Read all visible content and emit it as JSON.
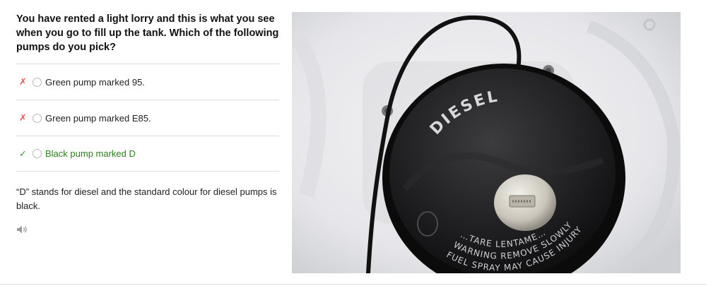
{
  "question": "You have rented a light lorry and this is what you see when you go to fill up the tank. Which of the following pumps do you pick?",
  "answers": [
    {
      "mark": "✗",
      "label": "Green pump marked 95.",
      "status": "incorrect"
    },
    {
      "mark": "✗",
      "label": "Green pump marked E85.",
      "status": "incorrect"
    },
    {
      "mark": "✓",
      "label": "Black pump marked D",
      "status": "correct"
    }
  ],
  "explanation": "“D” stands for diesel and the standard colour for diesel pumps is black.",
  "audio_icon": "speaker-icon",
  "photo": {
    "cap_label": "DIESEL",
    "warning_line1": "…TARE LENTAME…",
    "warning_line2": "WARNING REMOVE SLOWLY",
    "warning_line3": "FUEL SPRAY MAY CAUSE INJURY"
  },
  "colors": {
    "wrong_mark": "#e05a5a",
    "correct_mark": "#3a9a3a",
    "correct_text": "#2e7d1e"
  }
}
